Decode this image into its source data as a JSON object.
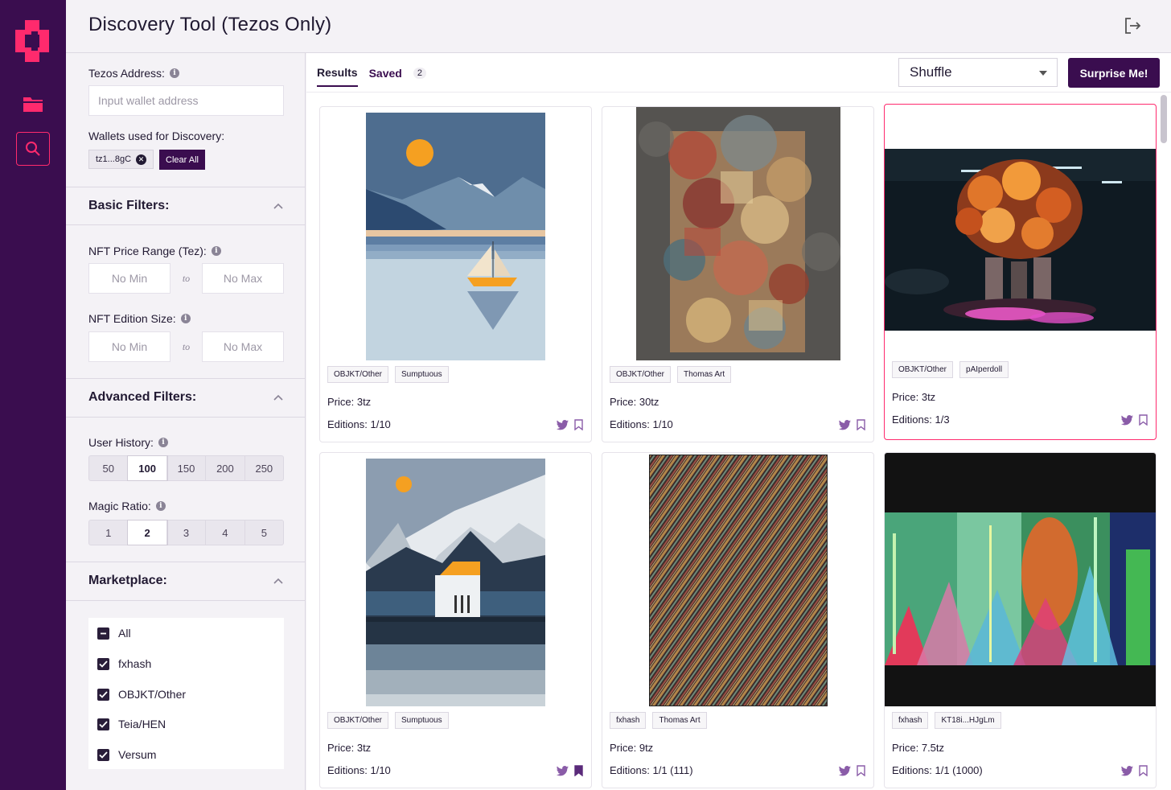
{
  "app": {
    "title": "Discovery Tool (Tezos Only)"
  },
  "nav": {
    "items": [
      "folder-icon",
      "search-icon"
    ]
  },
  "filters": {
    "address_label": "Tezos Address:",
    "address_placeholder": "Input wallet address",
    "wallets_label": "Wallets used for Discovery:",
    "wallet_chip": "tz1...8gC",
    "clear_all": "Clear All",
    "basic_title": "Basic Filters:",
    "price_label": "NFT Price Range (Tez):",
    "edition_label": "NFT Edition Size:",
    "min_placeholder": "No Min",
    "max_placeholder": "No Max",
    "to": "to",
    "advanced_title": "Advanced Filters:",
    "history_label": "User History:",
    "history_options": [
      "50",
      "100",
      "150",
      "200",
      "250"
    ],
    "history_selected": "100",
    "magic_label": "Magic Ratio:",
    "magic_options": [
      "1",
      "2",
      "3",
      "4",
      "5"
    ],
    "magic_selected": "2",
    "marketplace_title": "Marketplace:",
    "marketplaces": [
      "All",
      "fxhash",
      "OBJKT/Other",
      "Teia/HEN",
      "Versum"
    ]
  },
  "results": {
    "tab_results": "Results",
    "tab_saved": "Saved",
    "saved_count": "2",
    "sort_value": "Shuffle",
    "surprise": "Surprise Me!",
    "cards": [
      {
        "tags": [
          "OBJKT/Other",
          "Sumptuous"
        ],
        "price": "Price: 3tz",
        "editions": "Editions: 1/10",
        "saved": false
      },
      {
        "tags": [
          "OBJKT/Other",
          "Thomas Art"
        ],
        "price": "Price: 30tz",
        "editions": "Editions: 1/10",
        "saved": false
      },
      {
        "tags": [
          "OBJKT/Other",
          "pAIperdoll"
        ],
        "price": "Price: 3tz",
        "editions": "Editions: 1/3",
        "saved": false
      },
      {
        "tags": [
          "OBJKT/Other",
          "Sumptuous"
        ],
        "price": "Price: 3tz",
        "editions": "Editions: 1/10",
        "saved": true
      },
      {
        "tags": [
          "fxhash",
          "Thomas Art"
        ],
        "price": "Price: 9tz",
        "editions": "Editions: 1/1 (111)",
        "saved": false
      },
      {
        "tags": [
          "fxhash",
          "KT18i...HJgLm"
        ],
        "price": "Price: 7.5tz",
        "editions": "Editions: 1/1 (1000)",
        "saved": false
      }
    ]
  },
  "colors": {
    "brand": "#3a0d4f",
    "accent": "#ff2a6d",
    "action_icon": "#8a5ca8"
  }
}
